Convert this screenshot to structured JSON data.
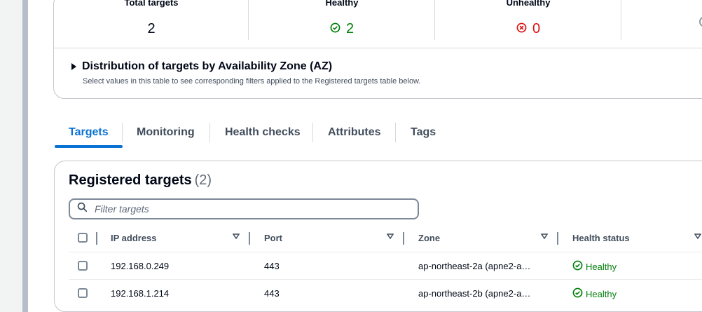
{
  "summary": {
    "metrics": [
      {
        "label": "Total targets",
        "value": "2"
      },
      {
        "label": "Healthy",
        "value": "2"
      },
      {
        "label": "Unhealthy",
        "value": "0"
      }
    ]
  },
  "az_section": {
    "title": "Distribution of targets by Availability Zone (AZ)",
    "description": "Select values in this table to see corresponding filters applied to the Registered targets table below."
  },
  "tabs": [
    {
      "label": "Targets",
      "active": true
    },
    {
      "label": "Monitoring"
    },
    {
      "label": "Health checks"
    },
    {
      "label": "Attributes"
    },
    {
      "label": "Tags"
    }
  ],
  "registered": {
    "title": "Registered targets",
    "count": "(2)",
    "filter_placeholder": "Filter targets",
    "columns": [
      "IP address",
      "Port",
      "Zone",
      "Health status"
    ],
    "rows": [
      {
        "ip": "192.168.0.249",
        "port": "443",
        "zone": "ap-northeast-2a (apne2-a…",
        "status": "Healthy"
      },
      {
        "ip": "192.168.1.214",
        "port": "443",
        "zone": "ap-northeast-2b (apne2-a…",
        "status": "Healthy"
      }
    ]
  },
  "colors": {
    "accent": "#0972d3",
    "healthy": "#037f0c",
    "unhealthy": "#d91515"
  }
}
